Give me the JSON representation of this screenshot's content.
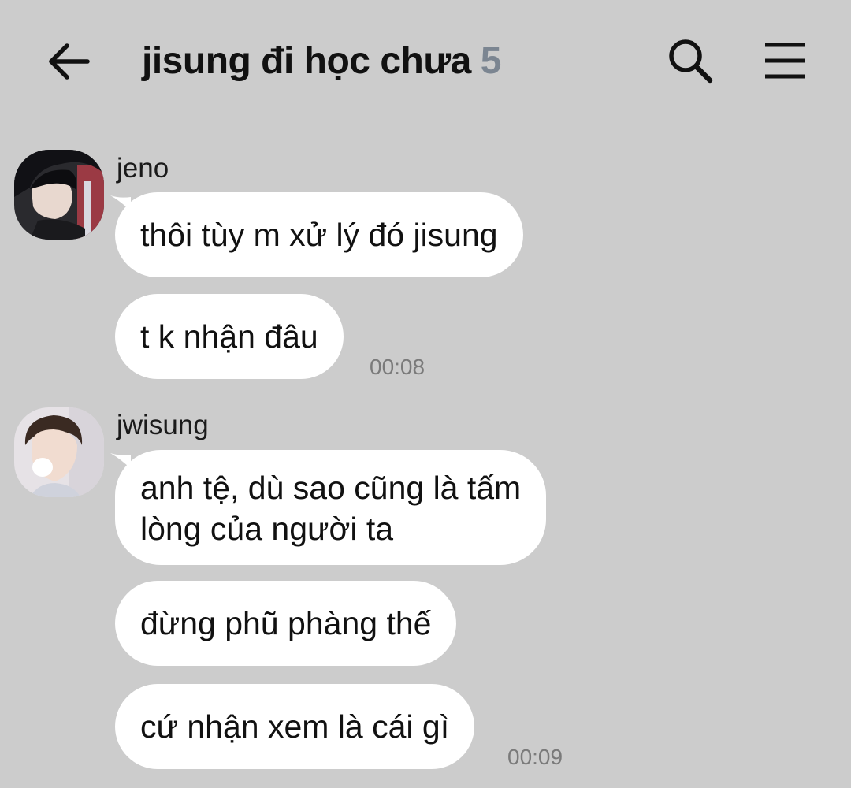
{
  "header": {
    "title": "jisung đi học chưa",
    "member_count": "5",
    "back_icon": "arrow-left-icon",
    "search_icon": "search-icon",
    "menu_icon": "hamburger-menu-icon"
  },
  "messages": [
    {
      "sender": "jeno",
      "lines": [
        "thôi tùy m xử lý đó jisung",
        "t k nhận đâu"
      ],
      "time": "00:08"
    },
    {
      "sender": "jwisung",
      "lines": [
        "anh tệ, dù sao cũng là tấm\nlòng của người ta",
        "đừng phũ phàng thế",
        "cứ nhận xem là cái gì"
      ],
      "time": "00:09"
    }
  ],
  "colors": {
    "background": "#cccccc",
    "bubble": "#ffffff",
    "title_count": "#7b8591",
    "timestamp": "#7a7a7a"
  }
}
